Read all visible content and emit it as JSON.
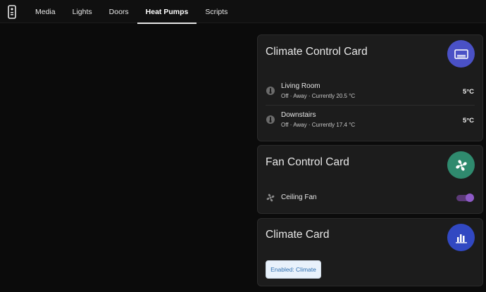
{
  "nav": {
    "tabs": [
      {
        "label": "Media"
      },
      {
        "label": "Lights"
      },
      {
        "label": "Doors"
      },
      {
        "label": "Heat Pumps"
      },
      {
        "label": "Scripts"
      }
    ],
    "active_tab": "Heat Pumps"
  },
  "cards": {
    "climate_control": {
      "title": "Climate Control Card",
      "icon": "air-conditioner-icon",
      "badge_color": "#4a51c6",
      "rows": [
        {
          "name": "Living Room",
          "status": "Off · Away · Currently 20.5 °C",
          "value": "5°C",
          "icon": "thermostat-icon"
        },
        {
          "name": "Downstairs",
          "status": "Off · Away · Currently 17.4 °C",
          "value": "5°C",
          "icon": "thermostat-icon"
        }
      ]
    },
    "fan_control": {
      "title": "Fan Control Card",
      "icon": "fan-icon",
      "badge_color": "#2f8a6e",
      "rows": [
        {
          "name": "Ceiling Fan",
          "icon": "fan-icon",
          "on": true
        }
      ]
    },
    "climate": {
      "title": "Climate Card",
      "icon": "bar-chart-icon",
      "badge_color": "#3148c2",
      "chip_label": "Enabled: Climate"
    }
  },
  "colors": {
    "background": "#0b0b0b",
    "card": "#1c1c1c",
    "toggle_on": "#8e5ac7",
    "chip_text": "#2e6fb0"
  }
}
